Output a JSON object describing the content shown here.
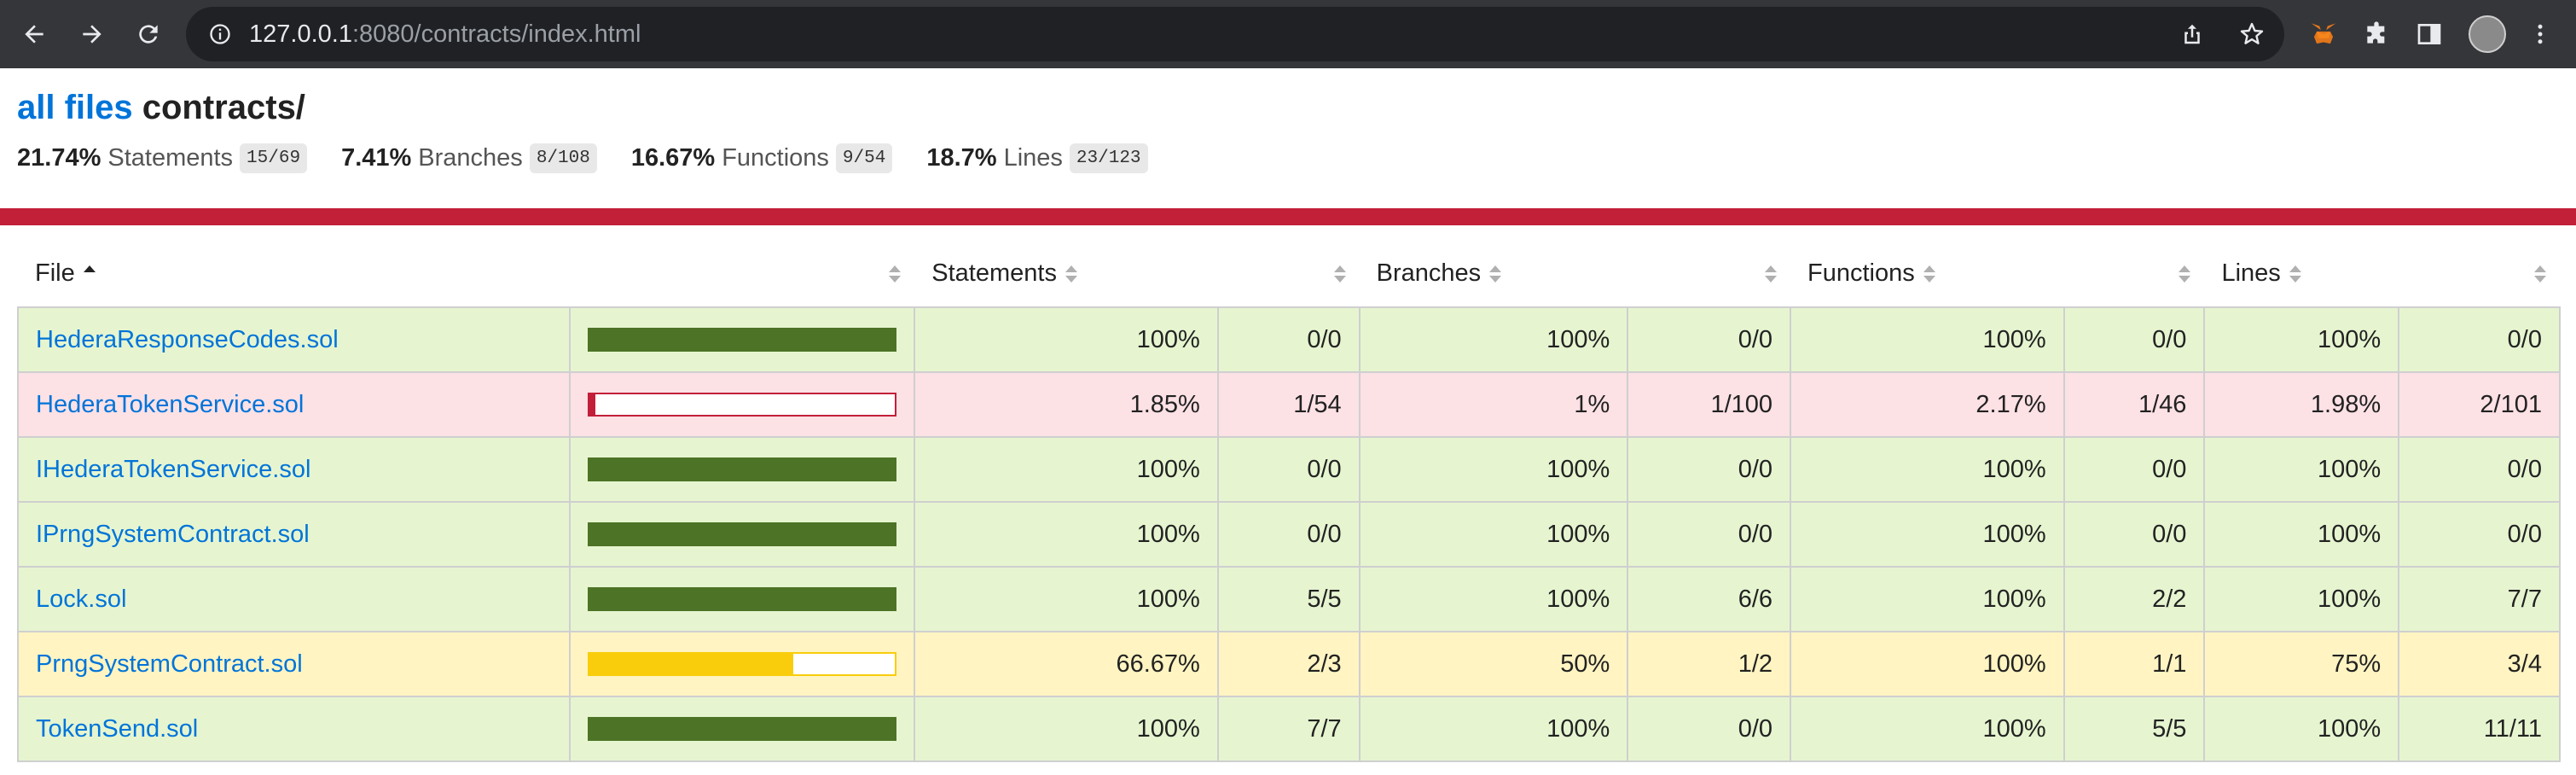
{
  "browser": {
    "url_host": "127.0.0.1",
    "url_path": ":8080/contracts/index.html"
  },
  "header": {
    "breadcrumb_link": "all files",
    "directory": "contracts/"
  },
  "summary": [
    {
      "pct": "21.74%",
      "label": "Statements",
      "frac": "15/69"
    },
    {
      "pct": "7.41%",
      "label": "Branches",
      "frac": "8/108"
    },
    {
      "pct": "16.67%",
      "label": "Functions",
      "frac": "9/54"
    },
    {
      "pct": "18.7%",
      "label": "Lines",
      "frac": "23/123"
    }
  ],
  "table": {
    "headers": {
      "file": "File",
      "statements": "Statements",
      "branches": "Branches",
      "functions": "Functions",
      "lines": "Lines"
    },
    "rows": [
      {
        "file": "HederaResponseCodes.sol",
        "level": "high",
        "coverage": 1.0,
        "st_pct": "100%",
        "st_frac": "0/0",
        "br_pct": "100%",
        "br_frac": "0/0",
        "fn_pct": "100%",
        "fn_frac": "0/0",
        "ln_pct": "100%",
        "ln_frac": "0/0"
      },
      {
        "file": "HederaTokenService.sol",
        "level": "low",
        "coverage": 0.0185,
        "st_pct": "1.85%",
        "st_frac": "1/54",
        "br_pct": "1%",
        "br_frac": "1/100",
        "fn_pct": "2.17%",
        "fn_frac": "1/46",
        "ln_pct": "1.98%",
        "ln_frac": "2/101"
      },
      {
        "file": "IHederaTokenService.sol",
        "level": "high",
        "coverage": 1.0,
        "st_pct": "100%",
        "st_frac": "0/0",
        "br_pct": "100%",
        "br_frac": "0/0",
        "fn_pct": "100%",
        "fn_frac": "0/0",
        "ln_pct": "100%",
        "ln_frac": "0/0"
      },
      {
        "file": "IPrngSystemContract.sol",
        "level": "high",
        "coverage": 1.0,
        "st_pct": "100%",
        "st_frac": "0/0",
        "br_pct": "100%",
        "br_frac": "0/0",
        "fn_pct": "100%",
        "fn_frac": "0/0",
        "ln_pct": "100%",
        "ln_frac": "0/0"
      },
      {
        "file": "Lock.sol",
        "level": "high",
        "coverage": 1.0,
        "st_pct": "100%",
        "st_frac": "5/5",
        "br_pct": "100%",
        "br_frac": "6/6",
        "fn_pct": "100%",
        "fn_frac": "2/2",
        "ln_pct": "100%",
        "ln_frac": "7/7"
      },
      {
        "file": "PrngSystemContract.sol",
        "level": "medium",
        "coverage": 0.6667,
        "st_pct": "66.67%",
        "st_frac": "2/3",
        "br_pct": "50%",
        "br_frac": "1/2",
        "fn_pct": "100%",
        "fn_frac": "1/1",
        "ln_pct": "75%",
        "ln_frac": "3/4"
      },
      {
        "file": "TokenSend.sol",
        "level": "high",
        "coverage": 1.0,
        "st_pct": "100%",
        "st_frac": "7/7",
        "br_pct": "100%",
        "br_frac": "0/0",
        "fn_pct": "100%",
        "fn_frac": "5/5",
        "ln_pct": "100%",
        "ln_frac": "11/11"
      }
    ]
  },
  "colors": {
    "status_bar": "#c21f39",
    "link": "#0074d9"
  }
}
